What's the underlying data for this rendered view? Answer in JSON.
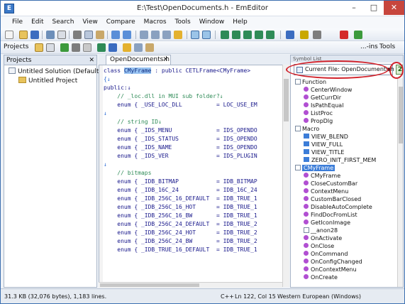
{
  "window": {
    "title": "E:\\Test\\OpenDocuments.h - EmEditor",
    "minimize": "–",
    "maximize": "□",
    "close": "✕"
  },
  "menu": [
    "File",
    "Edit",
    "Search",
    "View",
    "Compare",
    "Macros",
    "Tools",
    "Window",
    "Help"
  ],
  "toolbar": {
    "projects_label": "Projects",
    "ins_label": "...-ins",
    "tools_label": "Tools"
  },
  "projects": {
    "header": "Projects",
    "close": "✕",
    "solution": "Untitled Solution (Default)",
    "project": "Untitled Project"
  },
  "tab": {
    "label": "OpenDocuments.h",
    "close": "✕"
  },
  "code": {
    "line1_a": "class ",
    "line1_sel": "CMyFrame",
    "line1_b": " : public CETLFrame<CMyFrame>",
    "line2": "{↓",
    "line3": "public:↓",
    "line4": "    // _loc.dll in MUI sub folder?↓",
    "line5": "    enum { _USE_LOC_DLL          = LOC_USE_EM",
    "line6": "↓",
    "line7": "    // string ID↓",
    "line8": "    enum { _IDS_MENU             = IDS_OPENDO",
    "line9": "    enum { _IDS_STATUS           = IDS_OPENDO",
    "line10": "    enum { _IDS_NAME             = IDS_OPENDO",
    "line11": "    enum { _IDS_VER              = IDS_PLUGIN",
    "line12": "↓",
    "line13": "    // bitmaps",
    "line14": "    enum { _IDB_BITMAP           = IDB_BITMAP",
    "line15": "    enum { _IDB_16C_24           = IDB_16C_24",
    "line16": "    enum { _IDB_256C_16_DEFAULT  = IDB_TRUE_1",
    "line17": "    enum { _IDB_256C_16_HOT      = IDB_TRUE_1",
    "line18": "    enum { _IDB_256C_16_BW       = IDB_TRUE_1",
    "line19": "    enum { _IDB_256C_24_DEFAULT  = IDB_TRUE_2",
    "line20": "    enum { _IDB_256C_24_HOT      = IDB_TRUE_2",
    "line21": "    enum { _IDB_256C_24_BW       = IDB_TRUE_2",
    "line22": "    enum { _IDB_TRUE_16_DEFAULT  = IDB_TRUE_1"
  },
  "symbols": {
    "header": "Symbol List",
    "combo": "Current File: OpenDocuments.h",
    "combo_arrow": "▼",
    "refresh": "2",
    "items": [
      {
        "label": "Function",
        "kind": "group",
        "indent": 0
      },
      {
        "label": "CenterWindow",
        "kind": "fn",
        "indent": 1
      },
      {
        "label": "GetCurrDir",
        "kind": "fn",
        "indent": 1
      },
      {
        "label": "IsPathEqual",
        "kind": "fn",
        "indent": 1
      },
      {
        "label": "ListProc",
        "kind": "fn",
        "indent": 1
      },
      {
        "label": "PropDlg",
        "kind": "fn",
        "indent": 1
      },
      {
        "label": "Macro",
        "kind": "group",
        "indent": 0
      },
      {
        "label": "VIEW_BLEND",
        "kind": "macro",
        "indent": 1
      },
      {
        "label": "VIEW_FULL",
        "kind": "macro",
        "indent": 1
      },
      {
        "label": "VIEW_TITLE",
        "kind": "macro",
        "indent": 1
      },
      {
        "label": "ZERO_INIT_FIRST_MEM",
        "kind": "macro",
        "indent": 1
      },
      {
        "label": "CMyFrame",
        "kind": "selected",
        "indent": 0
      },
      {
        "label": "CMyFrame",
        "kind": "fn",
        "indent": 1
      },
      {
        "label": "CloseCustomBar",
        "kind": "fn",
        "indent": 1
      },
      {
        "label": "ContextMenu",
        "kind": "fn",
        "indent": 1
      },
      {
        "label": "CustomBarClosed",
        "kind": "fn",
        "indent": 1
      },
      {
        "label": "DisableAutoComplete",
        "kind": "fn",
        "indent": 1
      },
      {
        "label": "FindDocFromList",
        "kind": "fn",
        "indent": 1
      },
      {
        "label": "GetIconImage",
        "kind": "fn",
        "indent": 1
      },
      {
        "label": "__anon28",
        "kind": "group",
        "indent": 1
      },
      {
        "label": "OnActivate",
        "kind": "fn",
        "indent": 1
      },
      {
        "label": "OnClose",
        "kind": "fn",
        "indent": 1
      },
      {
        "label": "OnCommand",
        "kind": "fn",
        "indent": 1
      },
      {
        "label": "OnConfigChanged",
        "kind": "fn",
        "indent": 1
      },
      {
        "label": "OnContextMenu",
        "kind": "fn",
        "indent": 1
      },
      {
        "label": "OnCreate",
        "kind": "fn",
        "indent": 1
      }
    ]
  },
  "status": {
    "left": "31.3 KB (32,076 bytes), 1,183 lines.",
    "lang": "C++",
    "pos": "Ln 122, Col 15",
    "enc": "Western European (Windows)"
  },
  "colors": {
    "accent": "#3c7dd8",
    "highlight_ring": "#d1222b",
    "function_icon": "#b14fd2"
  }
}
